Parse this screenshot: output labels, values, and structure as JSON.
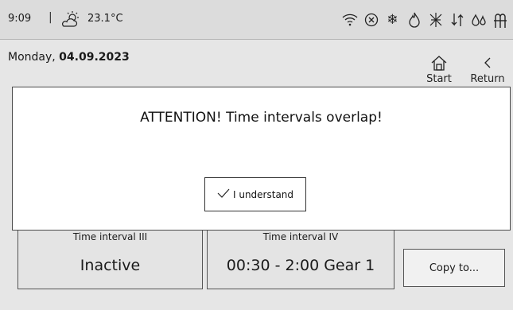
{
  "status_bar": {
    "time": "9:09",
    "separator": "|",
    "temperature": "23.1°C",
    "icons": [
      "wifi-icon",
      "cancel-circle-icon",
      "snowflake-icon",
      "flame-icon",
      "defrost-icon",
      "flow-arrows-icon",
      "water-drops-icon",
      "pipe-valve-icon"
    ]
  },
  "header": {
    "date_prefix": "Monday, ",
    "date_value": "04.09.2023",
    "start_label": "Start",
    "return_label": "Return"
  },
  "intervals": {
    "iii_title": "Time interval III",
    "iii_value": "Inactive",
    "iv_title": "Time interval IV",
    "iv_value": "00:30 - 2:00 Gear 1"
  },
  "copy_button_label": "Copy to...",
  "dialog": {
    "message": "ATTENTION! Time intervals overlap!",
    "confirm_label": "I understand"
  }
}
